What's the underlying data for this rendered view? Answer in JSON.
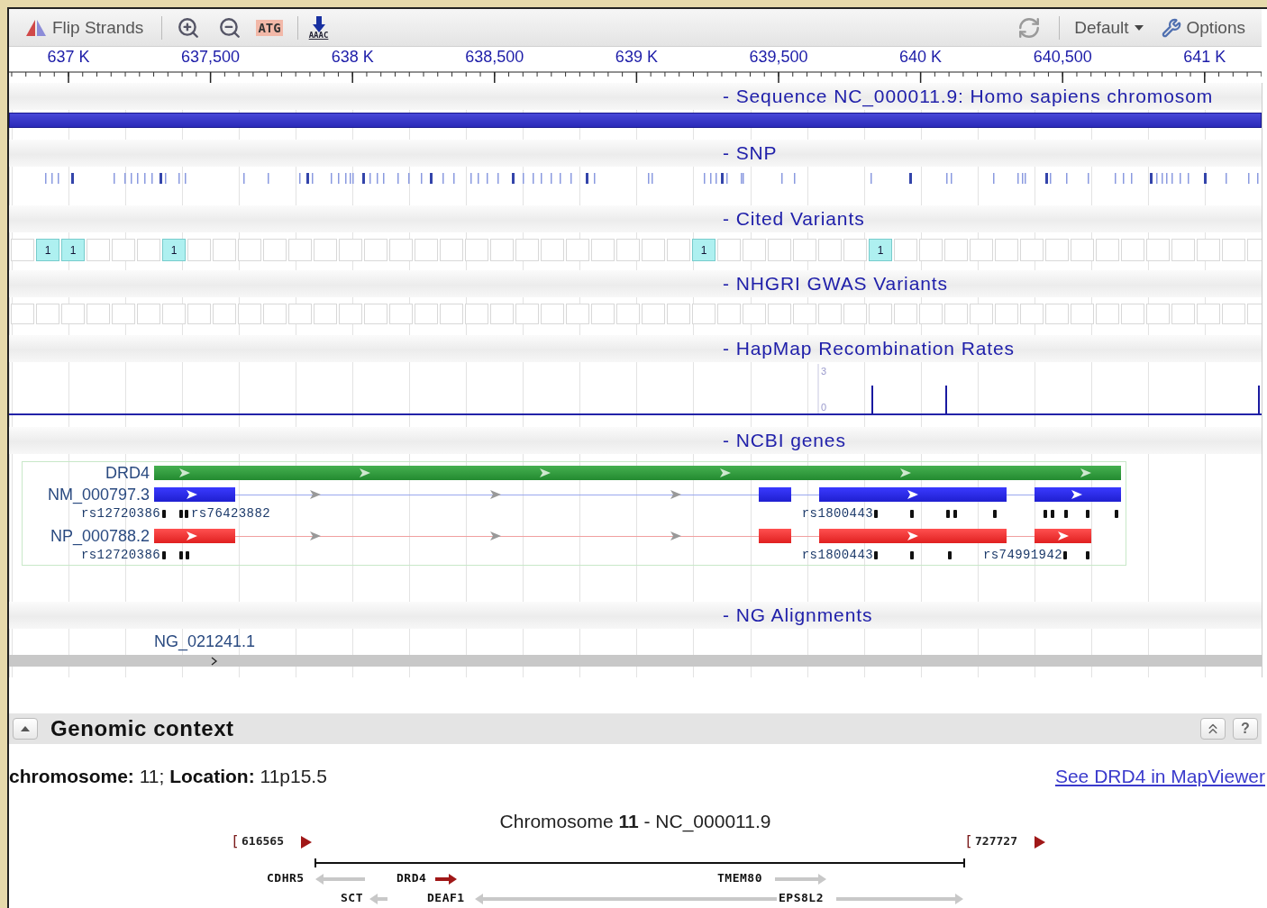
{
  "toolbar": {
    "flip_label": "Flip Strands",
    "atg_label": "ATG",
    "sequence_label": "AAAC",
    "preset": "Default",
    "options_label": "Options"
  },
  "ruler": {
    "labels": [
      "637 K",
      "637,500",
      "638 K",
      "638,500",
      "639 K",
      "639,500",
      "640 K",
      "640,500",
      "641 K"
    ]
  },
  "tracks": [
    {
      "kind": "sequence",
      "title": "- Sequence NC_000011.9: Homo sapiens chromosom"
    },
    {
      "kind": "snp",
      "title": "- SNP"
    },
    {
      "kind": "cited",
      "title": "- Cited Variants",
      "markers": [
        {
          "label": "1"
        },
        {
          "label": "1"
        },
        {
          "label": "1"
        },
        {
          "label": "1"
        },
        {
          "label": "1"
        }
      ]
    },
    {
      "kind": "gwas",
      "title": "- NHGRI GWAS Variants"
    },
    {
      "kind": "hapmap",
      "title": "- HapMap Recombination Rates",
      "axis_labels": [
        "3",
        "0"
      ]
    },
    {
      "kind": "genes",
      "title": "- NCBI genes",
      "rows": [
        {
          "kind": "gene",
          "label": "DRD4"
        },
        {
          "kind": "transcript",
          "label": "NM_000797.3"
        },
        {
          "kind": "snps",
          "snps": [
            {
              "label": "rs12720386"
            },
            {
              "label": "rs76423882"
            },
            {
              "label": "rs1800443"
            }
          ]
        },
        {
          "kind": "protein",
          "label": "NP_000788.2"
        },
        {
          "kind": "snps",
          "snps": [
            {
              "label": "rs12720386"
            },
            {
              "label": "rs1800443"
            },
            {
              "label": "rs74991942"
            }
          ]
        }
      ]
    },
    {
      "kind": "alignments",
      "title": "- NG Alignments",
      "items": [
        {
          "label": "NG_021241.1"
        }
      ]
    }
  ],
  "genomic_context": {
    "title": "Genomic context",
    "expanded": true,
    "help_label": "?",
    "location": "**chromosome:** 11; **Location:** 11p15.5",
    "link": "See DRD4 in MapViewer",
    "map_title": "Chromosome **11** - NC_000011.9",
    "range_start": {
      "bracket": "[",
      "value": "616565"
    },
    "range_end": {
      "bracket": "[",
      "value": "727727"
    },
    "genes": [
      {
        "name": "CDHR5",
        "reverse_strand": true,
        "highlighted": false
      },
      {
        "name": "DRD4",
        "reverse_strand": false,
        "highlighted": true
      },
      {
        "name": "TMEM80",
        "reverse_strand": false,
        "highlighted": false
      },
      {
        "name": "SCT",
        "reverse_strand": true,
        "highlighted": false
      },
      {
        "name": "DEAF1",
        "reverse_strand": true,
        "highlighted": false
      },
      {
        "name": "EPS8L2",
        "reverse_strand": false,
        "highlighted": false
      }
    ]
  }
}
